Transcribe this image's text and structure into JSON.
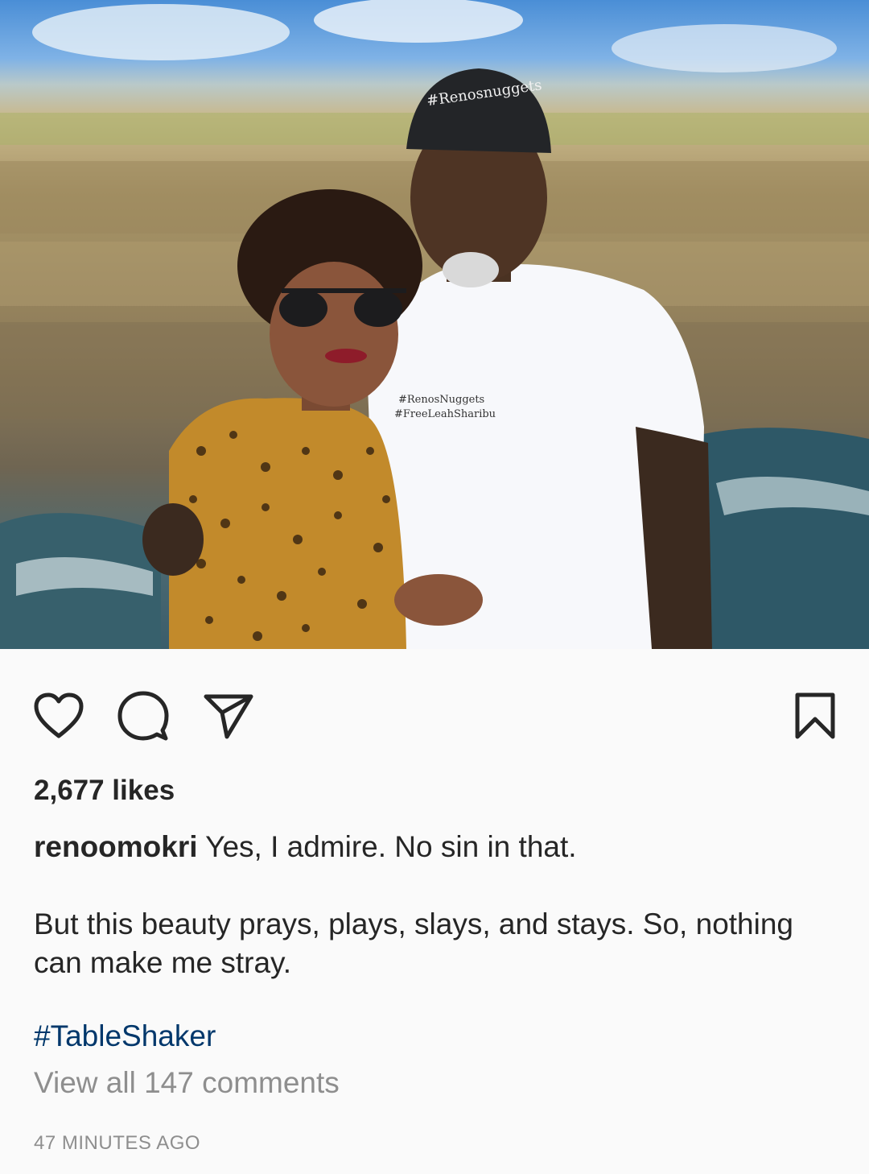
{
  "post": {
    "likes_text": "2,677 likes",
    "username": "renoomokri",
    "caption_line1": "Yes, I admire. No sin in that.",
    "caption_line2": "But this beauty prays, plays, slays, and stays. So, nothing can make me stray.",
    "hashtag": "#TableShaker",
    "view_comments": "View all 147 comments",
    "timestamp": "47 MINUTES AGO"
  },
  "actions": {
    "like_icon": "heart-icon",
    "comment_icon": "comment-icon",
    "share_icon": "send-icon",
    "save_icon": "bookmark-icon"
  },
  "colors": {
    "text": "#262626",
    "secondary": "#8e8e8e",
    "link": "#00376b",
    "background": "#fafafa"
  }
}
